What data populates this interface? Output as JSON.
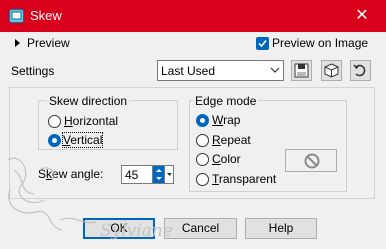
{
  "window": {
    "title": "Skew",
    "close_glyph": "✕",
    "icon": "skew-app-icon",
    "accent": "#d9001b"
  },
  "preview": {
    "label": "Preview",
    "toggle_icon": "triangle-right-icon",
    "preview_on_image": {
      "label": "Preview on Image",
      "checked": true
    }
  },
  "settings": {
    "label": "Settings",
    "preset_value": "Last Used",
    "tools": [
      "save-preset-icon",
      "load-preset-icon",
      "reset-icon"
    ]
  },
  "skew_direction": {
    "title": "Skew direction",
    "options": [
      {
        "label": "Horizontal",
        "selected": false
      },
      {
        "label": "Vertical",
        "selected": true
      }
    ]
  },
  "edge_mode": {
    "title": "Edge mode",
    "options": [
      {
        "label": "Wrap",
        "selected": true
      },
      {
        "label": "Repeat",
        "selected": false
      },
      {
        "label": "Color",
        "selected": false
      },
      {
        "label": "Transparent",
        "selected": false
      }
    ],
    "color_icon": "no-color-icon"
  },
  "skew_angle": {
    "label": "Skew angle:",
    "value": "45"
  },
  "buttons": {
    "ok": "OK",
    "cancel": "Cancel",
    "help": "Help"
  },
  "watermark": {
    "text": "Sylviane"
  },
  "colors": {
    "accent_blue": "#0067c0",
    "title_red": "#d9001b"
  }
}
